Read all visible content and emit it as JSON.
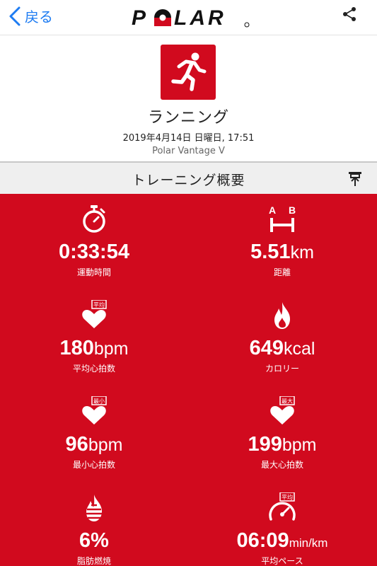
{
  "nav": {
    "back_label": "戻る",
    "logo_text": "POLAR"
  },
  "activity": {
    "sport_icon": "running-person-icon",
    "sport": "ランニング",
    "datetime": "2019年4月14日 日曜日, 17:51",
    "device": "Polar Vantage V"
  },
  "section": {
    "title": "トレーニング概要",
    "action_icon": "pin-icon"
  },
  "stats": {
    "duration": {
      "icon": "stopwatch-icon",
      "value": "0:33:54",
      "unit": "",
      "label": "運動時間"
    },
    "distance": {
      "icon": "distance-ab-icon",
      "icon_a": "A",
      "icon_b": "B",
      "value": "5.51",
      "unit": "km",
      "label": "距離"
    },
    "avg_hr": {
      "icon": "heart-avg-icon",
      "badge": "平均",
      "value": "180",
      "unit": "bpm",
      "label": "平均心拍数"
    },
    "calories": {
      "icon": "flame-icon",
      "value": "649",
      "unit": "kcal",
      "label": "カロリー"
    },
    "min_hr": {
      "icon": "heart-min-icon",
      "badge": "最小",
      "value": "96",
      "unit": "bpm",
      "label": "最小心拍数"
    },
    "max_hr": {
      "icon": "heart-max-icon",
      "badge": "最大",
      "value": "199",
      "unit": "bpm",
      "label": "最大心拍数"
    },
    "fat_burn": {
      "icon": "fat-burn-icon",
      "value": "6%",
      "unit": "",
      "label": "脂肪燃焼"
    },
    "avg_pace": {
      "icon": "pace-gauge-icon",
      "badge": "平均",
      "value": "06:09",
      "unit": "min/km",
      "label": "平均ペース"
    }
  },
  "colors": {
    "brand_red": "#d10a1e",
    "link_blue": "#1e7cf2"
  }
}
